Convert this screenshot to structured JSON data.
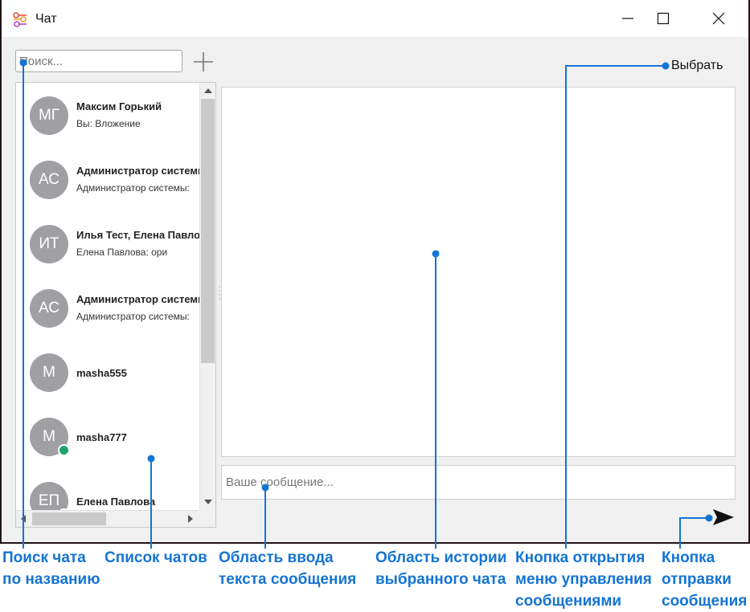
{
  "window": {
    "title": "Чат",
    "accent_color": "#1474d4"
  },
  "toolbar": {
    "search_placeholder": "Поиск...",
    "select_label": "Выбрать"
  },
  "chats": [
    {
      "initials": "МГ",
      "name": "Максим Горький",
      "preview": "Вы: Вложение",
      "online": false
    },
    {
      "initials": "АС",
      "name": "Администратор системы",
      "preview": "Администратор системы:",
      "online": false
    },
    {
      "initials": "ИТ",
      "name": "Илья Тест, Елена Павлова",
      "preview": "Елена Павлова: ори",
      "online": false
    },
    {
      "initials": "АС",
      "name": "Администратор системы",
      "preview": "Администратор системы:",
      "online": false
    },
    {
      "initials": "М",
      "name": "masha555",
      "preview": "",
      "online": false
    },
    {
      "initials": "М",
      "name": "masha777",
      "preview": "",
      "online": true
    },
    {
      "initials": "ЕП",
      "name": "Елена Павлова",
      "preview": "",
      "online": true
    }
  ],
  "composer": {
    "placeholder": "Ваше сообщение..."
  },
  "annotations": [
    "Поиск чата\nпо названию",
    "Список чатов",
    "Область ввода\nтекста сообщения",
    "Область истории\nвыбранного чата",
    "Кнопка открытия\nменю управления\nсообщениями",
    "Кнопка\nотправки\nсообщения"
  ]
}
